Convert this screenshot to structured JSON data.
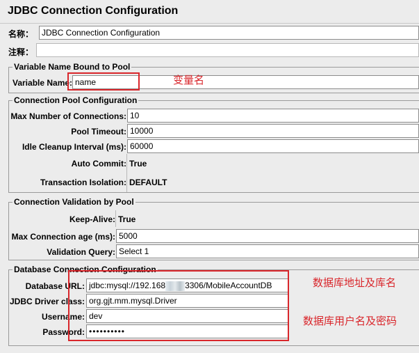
{
  "title": "JDBC Connection Configuration",
  "name_label": "名称：",
  "name_value": "JDBC Connection Configuration",
  "comment_label": "注释：",
  "comment_value": "",
  "var_section": {
    "legend": "Variable Name Bound to Pool",
    "var_label": "Variable Name:",
    "var_value": "name",
    "annotation": "变量名"
  },
  "pool_section": {
    "legend": "Connection Pool Configuration",
    "max_conn_label": "Max Number of Connections:",
    "max_conn_value": "10",
    "timeout_label": "Pool Timeout:",
    "timeout_value": "10000",
    "idle_label": "Idle Cleanup Interval (ms):",
    "idle_value": "60000",
    "autocommit_label": "Auto Commit:",
    "autocommit_value": "True",
    "isolation_label": "Transaction Isolation:",
    "isolation_value": "DEFAULT"
  },
  "validation_section": {
    "legend": "Connection Validation by Pool",
    "keepalive_label": "Keep-Alive:",
    "keepalive_value": "True",
    "maxage_label": "Max Connection age (ms):",
    "maxage_value": "5000",
    "query_label": "Validation Query:",
    "query_value": "Select 1"
  },
  "db_section": {
    "legend": "Database Connection Configuration",
    "url_label": "Database URL:",
    "url_prefix": "jdbc:mysql://192.168",
    "url_suffix": "3306/MobileAccountDB",
    "driver_label": "JDBC Driver class:",
    "driver_value": "org.gjt.mm.mysql.Driver",
    "user_label": "Username:",
    "user_value": "dev",
    "pass_label": "Password:",
    "pass_value": "••••••••••",
    "annotation_url": "数据库地址及库名",
    "annotation_user": "数据库用户名及密码"
  },
  "colors": {
    "annotation": "#d9262b",
    "background": "#ececec"
  }
}
